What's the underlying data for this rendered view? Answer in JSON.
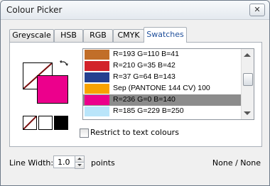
{
  "window": {
    "title": "Colour Picker",
    "close_glyph": "✕"
  },
  "tabs": [
    {
      "label": "Greyscale",
      "active": false
    },
    {
      "label": "HSB",
      "active": false
    },
    {
      "label": "RGB",
      "active": false
    },
    {
      "label": "CMYK",
      "active": false
    },
    {
      "label": "Swatches",
      "active": true
    }
  ],
  "colours": {
    "fill": "#ec008c",
    "stroke": "none"
  },
  "swatches": [
    {
      "label": "R=193 G=110 B=41",
      "color": "#c16e29",
      "selected": false
    },
    {
      "label": "R=210 G=35 B=42",
      "color": "#d2232a",
      "selected": false
    },
    {
      "label": "R=37 G=64 B=143",
      "color": "#25408f",
      "selected": false
    },
    {
      "label": "Sep (PANTONE 144 CV) 100",
      "color": "#f7a200",
      "selected": false
    },
    {
      "label": "R=236 G=0 B=140",
      "color": "#ec008c",
      "selected": true
    },
    {
      "label": "R=185 G=229 B=250",
      "color": "#b9e5fa",
      "selected": false
    }
  ],
  "restrict": {
    "label": "Restrict to text colours",
    "checked": false
  },
  "line_width": {
    "label": "Line Width:",
    "value": "1.0",
    "unit": "points"
  },
  "status": "None / None"
}
